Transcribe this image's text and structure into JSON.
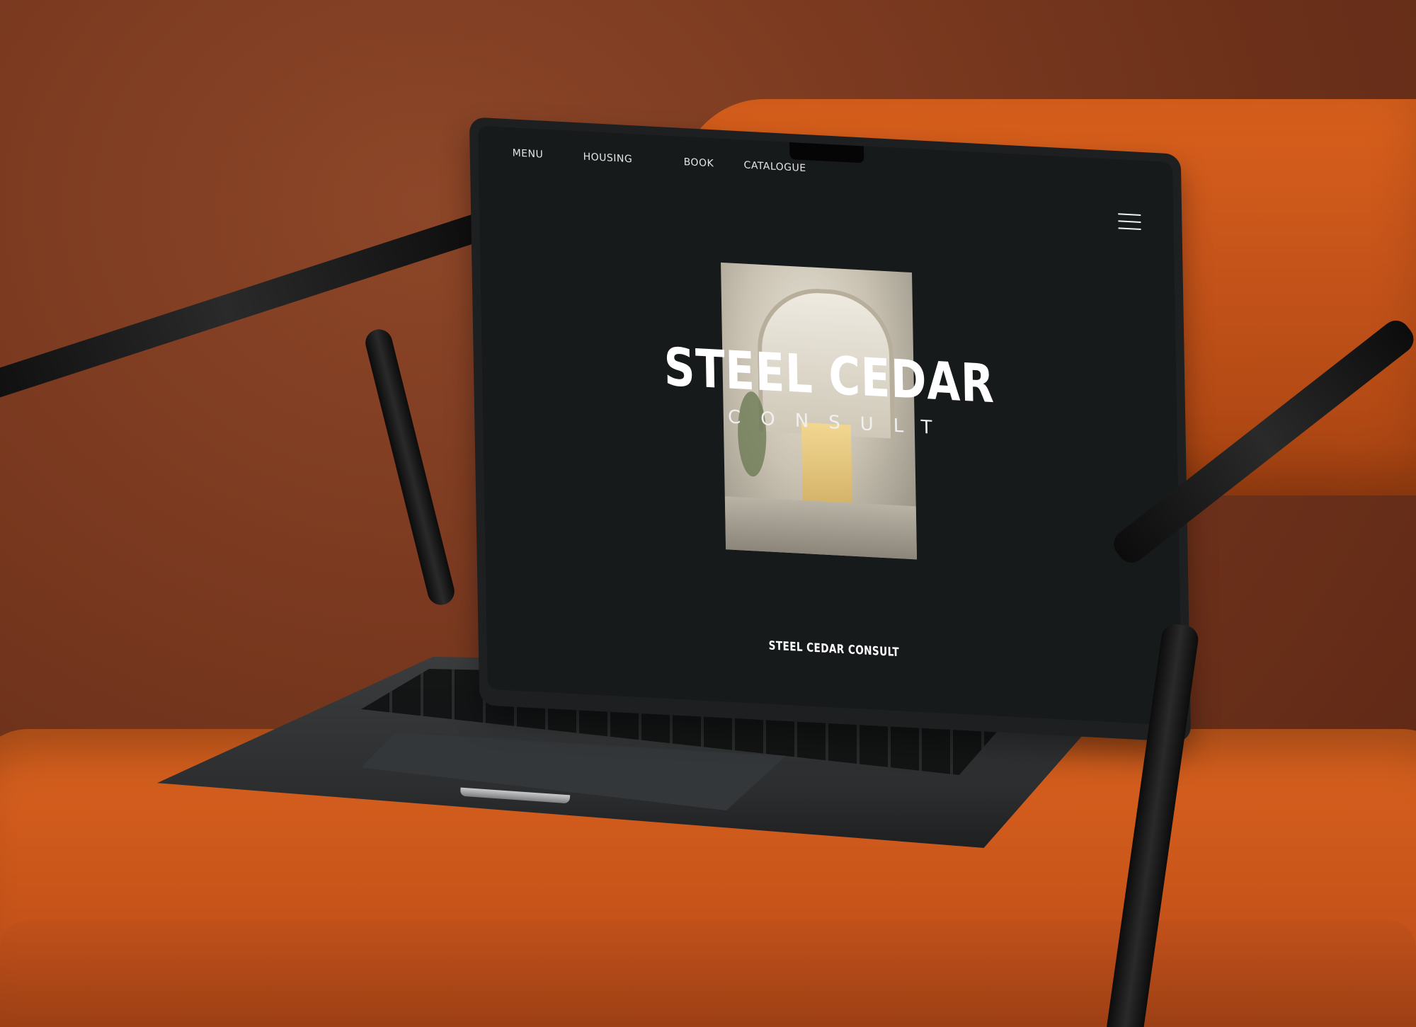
{
  "nav": {
    "menu": "MENU",
    "housing": "HOUSING",
    "book": "BOOK",
    "catalogue": "CATALOGUE"
  },
  "hero": {
    "title": "STEEL CEDAR",
    "subtitle": "CONSULT"
  },
  "footer": {
    "brand": "STEEL CEDAR CONSULT"
  },
  "icons": {
    "menu": "hamburger-icon"
  },
  "colors": {
    "screen_bg": "#161a1b",
    "text": "#ffffff",
    "chair": "#d15a1c",
    "wall": "#7a3a22"
  }
}
